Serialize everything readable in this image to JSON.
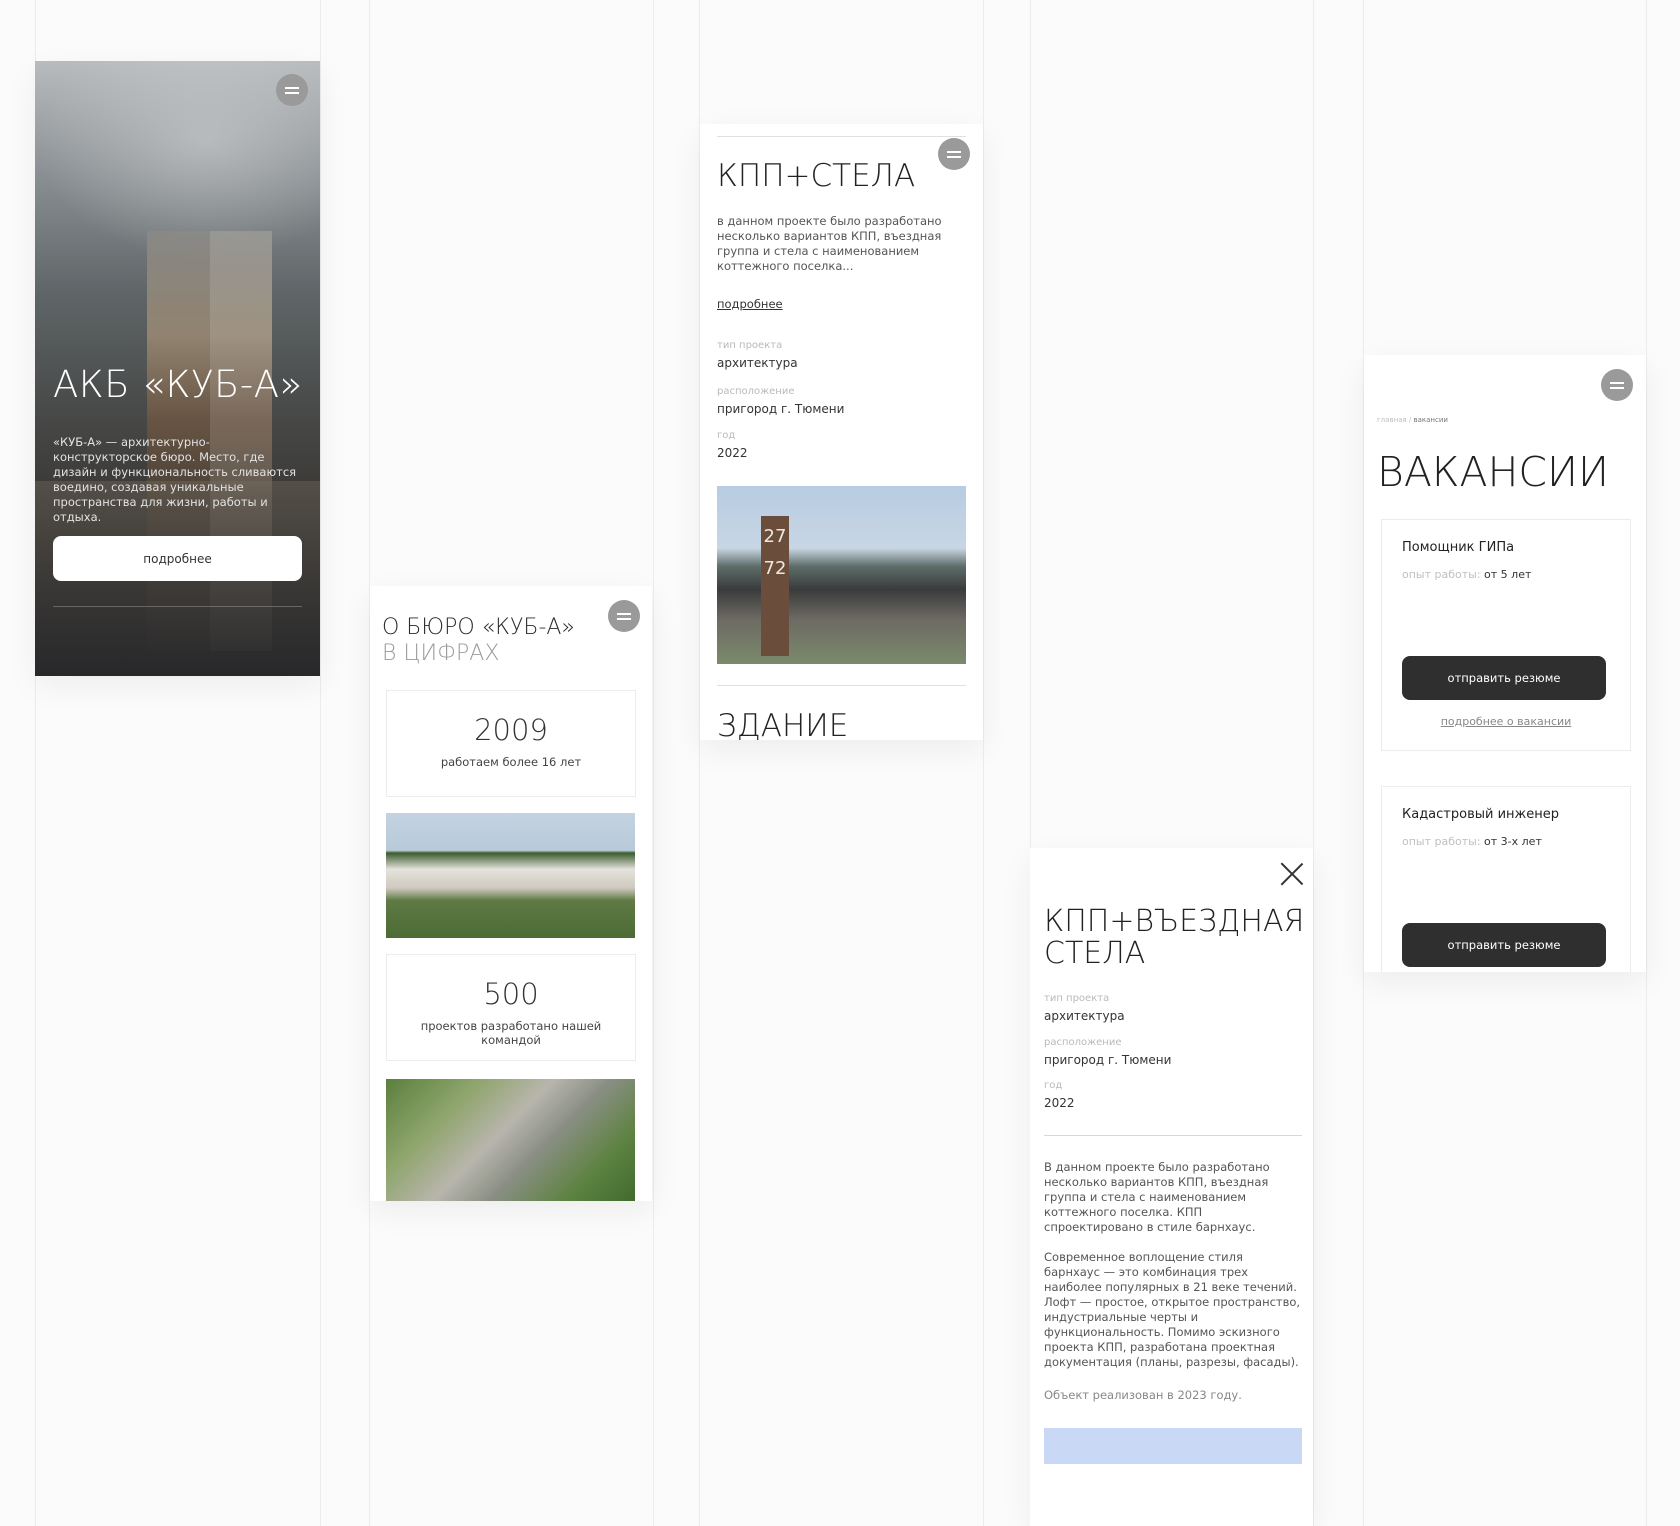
{
  "hero": {
    "title": "АКБ «КУБ-А»",
    "description": "«КУБ-А» — архитектурно-конструкторское бюро. Место, где дизайн и функциональность сливаются воедино, создавая уникальные пространства для жизни, работы и отдыха.",
    "button_label": "подробнее"
  },
  "about": {
    "title": "О БЮРО «КУБ-А»",
    "subtitle": "В ЦИФРАХ",
    "stats": [
      {
        "number": "2009",
        "label": "работаем более 16 лет"
      },
      {
        "number": "500",
        "label": "проектов разработано нашей командой"
      }
    ]
  },
  "project": {
    "title": "КПП+СТЕЛА",
    "description": "в данном проекте было разработано несколько вариантов КПП, въездная группа и стела с наименованием коттежного поселка...",
    "more_link": "подробнее",
    "meta": [
      {
        "label": "тип проекта",
        "value": "архитектура"
      },
      {
        "label": "расположение",
        "value": "пригород г. Тюмени"
      },
      {
        "label": "год",
        "value": "2022"
      }
    ],
    "stele_numbers": [
      "27",
      "72"
    ],
    "next_title": "ЗДАНИЕ"
  },
  "detail": {
    "title": "КПП+ВЪЕЗДНАЯ СТЕЛА",
    "meta": [
      {
        "label": "тип проекта",
        "value": "архитектура"
      },
      {
        "label": "расположение",
        "value": "пригород г. Тюмени"
      },
      {
        "label": "год",
        "value": "2022"
      }
    ],
    "paragraphs": [
      "В данном проекте было разработано несколько вариантов КПП, въездная группа и стела с наименованием коттежного поселка. КПП спроектировано в стиле барнхаус.",
      "Современное воплощение стиля барнхаус — это комбинация трех наиболее популярных в 21 веке течений. Лофт — простое, открытое пространство, индустриальные черты и функциональность. Помимо эскизного проекта КПП, разработана проектная документация (планы, разрезы, фасады).",
      "Объект реализован в 2023 году."
    ]
  },
  "vacancies": {
    "breadcrumb_home": "главная",
    "breadcrumb_sep": "/",
    "breadcrumb_current": "вакансии",
    "title": "ВАКАНСИИ",
    "experience_label": "опыт работы:",
    "submit_label": "отправить резюме",
    "details_link": "подробнее о вакансии",
    "items": [
      {
        "title": "Помощник ГИПа",
        "experience": "от 5 лет"
      },
      {
        "title": "Кадастровый инженер",
        "experience": "от 3-х лет"
      }
    ]
  }
}
